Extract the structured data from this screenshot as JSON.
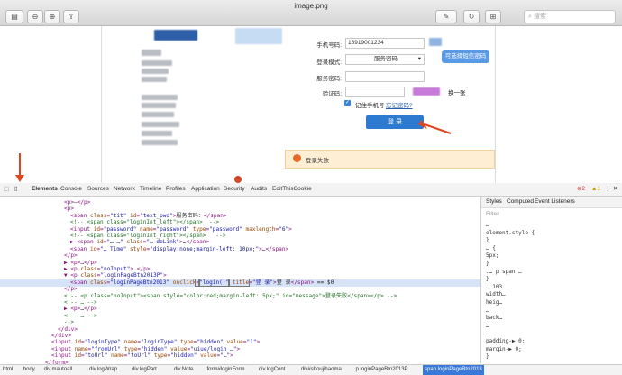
{
  "window": {
    "title": "image.png"
  },
  "toolbar": {
    "sidebar_icon": "sidebar-icon",
    "zoom_out_icon": "zoom-out-icon",
    "zoom_in_icon": "zoom-in-icon",
    "share_icon": "share-icon",
    "markup_icon": "pen-icon",
    "rotate_icon": "rotate-icon",
    "toolbox_icon": "toolbox-icon",
    "search_placeholder": "搜索"
  },
  "page": {
    "login_form": {
      "phone_label": "手机号码:",
      "phone_value": "18919001234",
      "mode_label": "登录模式:",
      "mode_value": "服务密码",
      "password_label": "服务密码:",
      "captcha_label": "验证码:",
      "captcha_refresh": "换一张",
      "remember_label": "记住手机号",
      "forgot_link": "忘记密码?",
      "login_button": "登 录",
      "sms_hint": "可选择短信密码",
      "error_message": "登录失败"
    }
  },
  "devtools": {
    "tabs": [
      "Elements",
      "Console",
      "Sources",
      "Network",
      "Timeline",
      "Profiles",
      "Application",
      "Security",
      "Audits",
      "EditThisCookie"
    ],
    "active_tab": "Elements",
    "error_count": "2",
    "warning_count": "1",
    "code_lines": [
      {
        "indent": 3,
        "segments": [
          [
            "tag",
            "<p>"
          ],
          [
            "txt",
            "–"
          ],
          [
            "tag",
            "</p>"
          ]
        ]
      },
      {
        "indent": 3,
        "segments": [
          [
            "tag",
            "<p>"
          ]
        ]
      },
      {
        "indent": 4,
        "segments": [
          [
            "tag",
            "<span "
          ],
          [
            "attr",
            "class"
          ],
          [
            "tag",
            "="
          ],
          [
            "val",
            "\"tit\""
          ],
          [
            "attr",
            " id"
          ],
          [
            "tag",
            "="
          ],
          [
            "val",
            "\"text_pwd\""
          ],
          [
            "tag",
            ">"
          ],
          [
            "txt",
            "服务密码："
          ],
          [
            "tag",
            "</span>"
          ]
        ]
      },
      {
        "indent": 4,
        "segments": [
          [
            "cmt",
            "<!-- <span class=\"loginInt_left\"></span>  -->"
          ]
        ]
      },
      {
        "indent": 4,
        "segments": [
          [
            "tag",
            "<input "
          ],
          [
            "attr",
            "id"
          ],
          [
            "tag",
            "="
          ],
          [
            "val",
            "\"password\""
          ],
          [
            "attr",
            " name"
          ],
          [
            "tag",
            "="
          ],
          [
            "val",
            "\"password\""
          ],
          [
            "attr",
            " type"
          ],
          [
            "tag",
            "="
          ],
          [
            "val",
            "\"password\""
          ],
          [
            "attr",
            " maxlength"
          ],
          [
            "tag",
            "="
          ],
          [
            "val",
            "\"6\""
          ],
          [
            "tag",
            ">"
          ]
        ]
      },
      {
        "indent": 4,
        "segments": [
          [
            "cmt",
            "<!-- <span class=\"loginInt_right\"></span>   -->"
          ]
        ]
      },
      {
        "indent": 4,
        "segments": [
          [
            "tag",
            "▶ <span "
          ],
          [
            "attr",
            "id"
          ],
          [
            "tag",
            "="
          ],
          [
            "val",
            "\"… …\""
          ],
          [
            "attr",
            " class"
          ],
          [
            "tag",
            "="
          ],
          [
            "val",
            "\"… deLink\""
          ],
          [
            "tag",
            ">"
          ],
          [
            "txt",
            "…"
          ],
          [
            "tag",
            "</span>"
          ]
        ]
      },
      {
        "indent": 4,
        "segments": [
          [
            "tag",
            "<span "
          ],
          [
            "attr",
            "id"
          ],
          [
            "tag",
            "="
          ],
          [
            "val",
            "\"… Time\""
          ],
          [
            "attr",
            " style"
          ],
          [
            "tag",
            "="
          ],
          [
            "val",
            "\"display:none;margin-left: 10px;\""
          ],
          [
            "tag",
            ">"
          ],
          [
            "txt",
            "…"
          ],
          [
            "tag",
            "</span>"
          ]
        ]
      },
      {
        "indent": 3,
        "segments": [
          [
            "tag",
            "</p>"
          ]
        ]
      },
      {
        "indent": 3,
        "segments": [
          [
            "tag",
            "▶ <p>"
          ],
          [
            "txt",
            "…"
          ],
          [
            "tag",
            "</p>"
          ]
        ]
      },
      {
        "indent": 3,
        "segments": [
          [
            "tag",
            "▶ <p "
          ],
          [
            "attr",
            "class"
          ],
          [
            "tag",
            "="
          ],
          [
            "val",
            "\"noInput\""
          ],
          [
            "tag",
            ">"
          ],
          [
            "txt",
            "…"
          ],
          [
            "tag",
            "</p>"
          ]
        ]
      },
      {
        "indent": 3,
        "segments": [
          [
            "tag",
            "▼ <p "
          ],
          [
            "attr",
            "class"
          ],
          [
            "tag",
            "="
          ],
          [
            "val",
            "\"loginPageBtn2013P\""
          ],
          [
            "tag",
            ">"
          ]
        ]
      },
      {
        "indent": 4,
        "segments": [
          [
            "tag",
            "<span "
          ],
          [
            "attr",
            "class"
          ],
          [
            "tag",
            "="
          ],
          [
            "val",
            "\"loginPageBtn2013\" "
          ],
          [
            "attr",
            "onclick"
          ],
          [
            "tag",
            "="
          ],
          [
            "val",
            "\"login()\""
          ],
          [
            "attr",
            " title"
          ],
          [
            "tag",
            "="
          ],
          [
            "val",
            "\"登 录\""
          ],
          [
            "tag",
            ">"
          ],
          [
            "txt",
            "登 录"
          ],
          [
            "tag",
            "</span>"
          ],
          [
            "txt",
            " == $0"
          ]
        ]
      },
      {
        "indent": 3,
        "segments": [
          [
            "tag",
            "</p>"
          ]
        ]
      },
      {
        "indent": 3,
        "segments": [
          [
            "cmt",
            "<!-- <p class=\"noInput\"><span style=\"color:red;margin-left: 5px;\" id=\"message\">登录失败</span></p> -->"
          ]
        ]
      },
      {
        "indent": 3,
        "segments": [
          [
            "cmt",
            "<!-- … -->"
          ]
        ]
      },
      {
        "indent": 3,
        "segments": [
          [
            "tag",
            "▶ <p>"
          ],
          [
            "txt",
            "…"
          ],
          [
            "tag",
            "</p>"
          ]
        ]
      },
      {
        "indent": 3,
        "segments": [
          [
            "cmt",
            "<!-- … -->"
          ]
        ]
      },
      {
        "indent": 3,
        "segments": [
          [
            "cmt",
            "-->"
          ]
        ]
      },
      {
        "indent": 2,
        "segments": [
          [
            "tag",
            "</div>"
          ]
        ]
      },
      {
        "indent": 1,
        "segments": [
          [
            "tag",
            "</div>"
          ]
        ]
      },
      {
        "indent": 1,
        "segments": [
          [
            "tag",
            "<input "
          ],
          [
            "attr",
            "id"
          ],
          [
            "tag",
            "="
          ],
          [
            "val",
            "\"loginType\""
          ],
          [
            "attr",
            " name"
          ],
          [
            "tag",
            "="
          ],
          [
            "val",
            "\"loginType\""
          ],
          [
            "attr",
            " type"
          ],
          [
            "tag",
            "="
          ],
          [
            "val",
            "\"hidden\""
          ],
          [
            "attr",
            " value"
          ],
          [
            "tag",
            "="
          ],
          [
            "val",
            "\"1\""
          ],
          [
            "tag",
            ">"
          ]
        ]
      },
      {
        "indent": 1,
        "segments": [
          [
            "tag",
            "<input "
          ],
          [
            "attr",
            "name"
          ],
          [
            "tag",
            "="
          ],
          [
            "val",
            "\"fromUrl\""
          ],
          [
            "attr",
            " type"
          ],
          [
            "tag",
            "="
          ],
          [
            "val",
            "\"hidden\""
          ],
          [
            "attr",
            " value"
          ],
          [
            "tag",
            "="
          ],
          [
            "val",
            "\"uiue/login …\""
          ],
          [
            "tag",
            ">"
          ]
        ]
      },
      {
        "indent": 1,
        "segments": [
          [
            "tag",
            "<input "
          ],
          [
            "attr",
            "id"
          ],
          [
            "tag",
            "="
          ],
          [
            "val",
            "\"toUrl\""
          ],
          [
            "attr",
            " name"
          ],
          [
            "tag",
            "="
          ],
          [
            "val",
            "\"toUrl\""
          ],
          [
            "attr",
            " type"
          ],
          [
            "tag",
            "="
          ],
          [
            "val",
            "\"hidden\""
          ],
          [
            "attr",
            " value"
          ],
          [
            "tag",
            "="
          ],
          [
            "val",
            "\"…\""
          ],
          [
            "tag",
            ">"
          ]
        ]
      },
      {
        "indent": 0,
        "segments": [
          [
            "tag",
            "</form>"
          ]
        ]
      }
    ],
    "styles": {
      "tabs": [
        "Styles",
        "Computed",
        "Event Listeners"
      ],
      "filter_placeholder": "Filter",
      "lines": [
        "…",
        "element.style {",
        "}",
        "… {",
        "5px;",
        "}",
        ".… p span …",
        "}",
        "… 103",
        "width…",
        "heig…",
        "…",
        "back…",
        "…",
        "…",
        "padding-▶ 0;",
        "margin-▶ 0;",
        "}"
      ]
    },
    "breadcrumbs": [
      "html",
      "body",
      "div.mautoall",
      "div.logWrap",
      "div.logPart",
      "div.Note",
      "form#loginForm",
      "div.logCont",
      "div#shoujihaoma",
      "p.loginPageBtn2013P",
      "span.loginPageBtn2013"
    ]
  },
  "colors": {
    "login_button": "#2e7ad1",
    "annotation_arrow": "#e2461f",
    "selected_row": "#d7e4f7"
  }
}
